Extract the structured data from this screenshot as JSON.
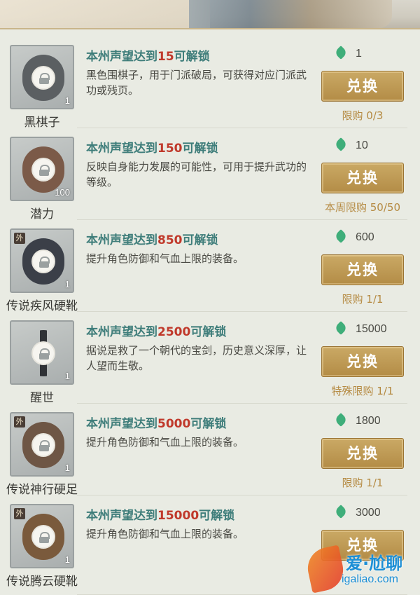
{
  "unlock_prefix": "本州声望达到",
  "unlock_suffix": "可解锁",
  "button_label": "兑换",
  "items": [
    {
      "name": "黑棋子",
      "unlock_value": "15",
      "description": "黑色围棋子，用于门派破局，可获得对应门派武功或残页。",
      "price": "1",
      "limit": "限购 0/3",
      "count": "1",
      "quality_badge": "",
      "icon": "black-go-stone-icon",
      "art_color": "#5b5f62"
    },
    {
      "name": "潜力",
      "unlock_value": "150",
      "description": "反映自身能力发展的可能性，可用于提升武功的等级。",
      "price": "10",
      "limit": "本周限购 50/50",
      "count": "100",
      "quality_badge": "",
      "icon": "potential-pouch-icon",
      "art_color": "#7b5a48"
    },
    {
      "name": "传说疾风硬靴",
      "unlock_value": "850",
      "description": "提升角色防御和气血上限的装备。",
      "price": "600",
      "limit": "限购 1/1",
      "count": "1",
      "quality_badge": "外",
      "icon": "boots-icon",
      "art_color": "#3b3f48"
    },
    {
      "name": "醒世",
      "unlock_value": "2500",
      "description": "据说是救了一个朝代的宝剑，历史意义深厚，让人望而生敬。",
      "price": "15000",
      "limit": "特殊限购 1/1",
      "count": "1",
      "quality_badge": "",
      "icon": "sword-icon",
      "art_color": "#2f3236"
    },
    {
      "name": "传说神行硬足",
      "unlock_value": "5000",
      "description": "提升角色防御和气血上限的装备。",
      "price": "1800",
      "limit": "限购 1/1",
      "count": "1",
      "quality_badge": "外",
      "icon": "boots-icon",
      "art_color": "#6e5645"
    },
    {
      "name": "传说腾云硬靴",
      "unlock_value": "15000",
      "description": "提升角色防御和气血上限的装备。",
      "price": "3000",
      "limit": "",
      "count": "1",
      "quality_badge": "外",
      "icon": "boots-icon",
      "art_color": "#7a5a3c"
    }
  ],
  "watermark": {
    "title": "爱·尬聊",
    "url": "igaliao.com"
  },
  "colors": {
    "accent_teal": "#3e7d7a",
    "threshold_red": "#c0392b",
    "button_gold": "#b38c46",
    "jade_green": "#3fae7a"
  }
}
